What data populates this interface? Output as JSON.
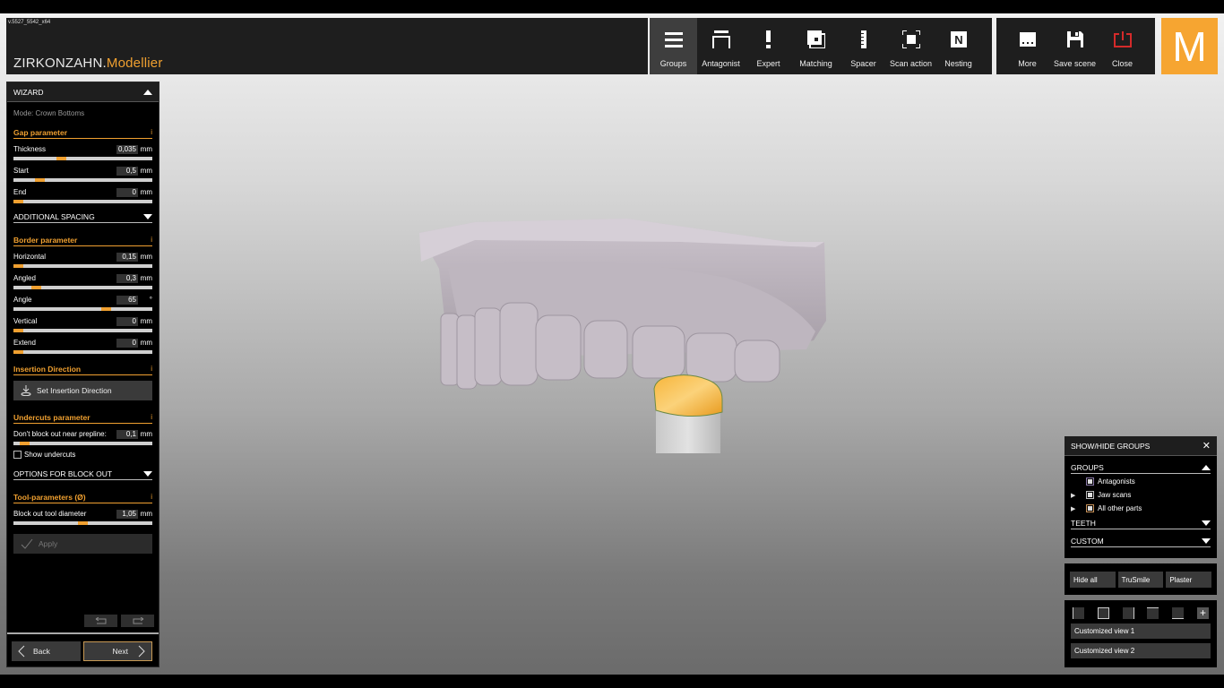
{
  "app": {
    "version": "v.5527_5542_x64",
    "title_main": "ZIRKONZAHN",
    "title_dot": ".",
    "title_accent": "Modellier",
    "logo_letter": "M",
    "accent_color": "#f0a030",
    "logo_color": "#f6a531"
  },
  "toolbar": {
    "items": [
      {
        "label": "Groups",
        "icon": "hamburger-icon",
        "active": true
      },
      {
        "label": "Antagonist",
        "icon": "antagonist-icon"
      },
      {
        "label": "Expert",
        "icon": "exclamation-icon"
      },
      {
        "label": "Matching",
        "icon": "matching-icon"
      },
      {
        "label": "Spacer",
        "icon": "ruler-icon"
      },
      {
        "label": "Scan action",
        "icon": "scan-frame-icon"
      },
      {
        "label": "Nesting",
        "icon": "nesting-n-icon"
      }
    ],
    "right_items": [
      {
        "label": "More",
        "icon": "more-dots-icon"
      },
      {
        "label": "Save scene",
        "icon": "floppy-save-icon"
      },
      {
        "label": "Close",
        "icon": "power-close-icon"
      }
    ]
  },
  "wizard": {
    "title": "WIZARD",
    "mode": "Mode: Crown Bottoms",
    "gap_section": "Gap parameter",
    "gap_params": [
      {
        "label": "Thickness",
        "value": "0,035",
        "unit": "mm",
        "slider_fraction": 0.33
      },
      {
        "label": "Start",
        "value": "0,5",
        "unit": "mm",
        "slider_fraction": 0.17
      },
      {
        "label": "End",
        "value": "0",
        "unit": "mm",
        "slider_fraction": 0.0
      }
    ],
    "additional_spacing": "ADDITIONAL SPACING",
    "border_section": "Border parameter",
    "border_params": [
      {
        "label": "Horizontal",
        "value": "0,15",
        "unit": "mm",
        "slider_fraction": 0.0
      },
      {
        "label": "Angled",
        "value": "0,3",
        "unit": "mm",
        "slider_fraction": 0.14
      },
      {
        "label": "Angle",
        "value": "65",
        "unit": "°",
        "slider_fraction": 0.68
      },
      {
        "label": "Vertical",
        "value": "0",
        "unit": "mm",
        "slider_fraction": 0.0
      },
      {
        "label": "Extend",
        "value": "0",
        "unit": "mm",
        "slider_fraction": 0.0
      }
    ],
    "insertion_section": "Insertion Direction",
    "set_insertion_label": "Set Insertion Direction",
    "undercuts_section": "Undercuts parameter",
    "undercut_params": [
      {
        "label": "Don't block out near prepline:",
        "value": "0,1",
        "unit": "mm",
        "slider_fraction": 0.05
      }
    ],
    "show_undercuts_label": "Show undercuts",
    "show_undercuts_checked": false,
    "block_out_options": "OPTIONS FOR BLOCK OUT",
    "tool_section": "Tool-parameters (Ø)",
    "tool_params": [
      {
        "label": "Block out tool diameter",
        "value": "1,05",
        "unit": "mm",
        "slider_fraction": 0.5
      }
    ],
    "apply_label": "Apply",
    "info_glyph": "i",
    "back_label": "Back",
    "next_label": "Next"
  },
  "groups_panel": {
    "title": "SHOW/HIDE GROUPS",
    "groups_header": "GROUPS",
    "items": [
      {
        "label": "Antagonists",
        "expandable": false,
        "border_color": "#8a7aa8"
      },
      {
        "label": "Jaw scans",
        "expandable": true,
        "border_color": "#bbbbbb"
      },
      {
        "label": "All other parts",
        "expandable": true,
        "border_color": "#c8935a"
      }
    ],
    "teeth_header": "TEETH",
    "custom_header": "CUSTOM",
    "visibility_buttons": [
      "Hide all",
      "TruSmile",
      "Plaster"
    ],
    "view_buttons": [
      "Customized view 1",
      "Customized view 2"
    ]
  }
}
